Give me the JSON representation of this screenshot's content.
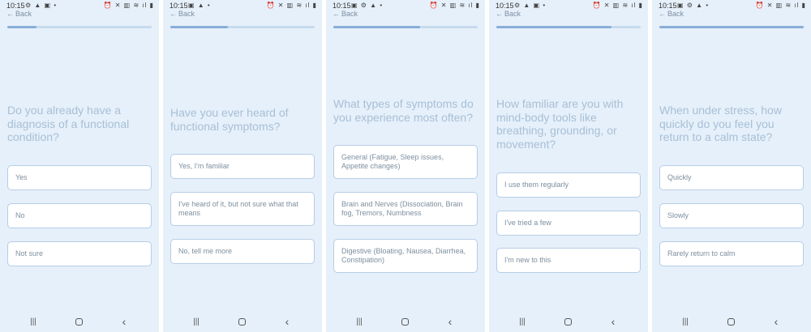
{
  "screens": [
    {
      "status": {
        "time": "10:15",
        "left_icons": "⚙ ▲ ▣ •",
        "right_icons": "⏰ ✕ ▥ ≋ ıl ▮"
      },
      "back_label": "Back",
      "progress": 0.2,
      "question": "Do you already have a diagnosis of a functional condition?",
      "options": [
        "Yes",
        "No",
        "Not sure"
      ]
    },
    {
      "status": {
        "time": "10:15",
        "left_icons": "▣ ▲ •",
        "right_icons": "⏰ ✕ ▥ ≋ ıl ▮"
      },
      "back_label": "Back",
      "progress": 0.4,
      "question": "Have you ever heard of functional symptoms?",
      "options": [
        "Yes, I'm familiar",
        "I've heard of it, but not sure what that means",
        "No, tell me more"
      ]
    },
    {
      "status": {
        "time": "10:15",
        "left_icons": "▣ ⚙ ▲ •",
        "right_icons": "⏰ ✕ ▥ ≋ ıl ▮"
      },
      "back_label": "Back",
      "progress": 0.6,
      "question": "What types of symptoms do you experience most often?",
      "options": [
        "General (Fatigue, Sleep issues, Appetite changes)",
        "Brain and Nerves (Dissociation, Brain fog, Tremors, Numbness",
        "Digestive (Bloating, Nausea, Diarrhea, Constipation)"
      ]
    },
    {
      "status": {
        "time": "10:15",
        "left_icons": "⚙ ▲ ▣ •",
        "right_icons": "⏰ ✕ ▥ ≋ ıl ▮"
      },
      "back_label": "Back",
      "progress": 0.8,
      "question": "How familiar are you with mind-body tools like breathing, grounding, or movement?",
      "options": [
        "I use them regularly",
        "I've tried a few",
        "I'm new to this"
      ]
    },
    {
      "status": {
        "time": "10:15",
        "left_icons": "▣ ⚙ ▲ •",
        "right_icons": "⏰ ✕ ▥ ≋ ıl ▮"
      },
      "back_label": "Back",
      "progress": 1.0,
      "question": "When under stress, how quickly do you feel you return to a calm state?",
      "options": [
        "Quickly",
        "Slowly",
        "Rarely return to calm"
      ]
    }
  ],
  "navbar": {
    "recents_icon": "|||",
    "home_icon": "home-icon",
    "back_icon": "‹"
  }
}
